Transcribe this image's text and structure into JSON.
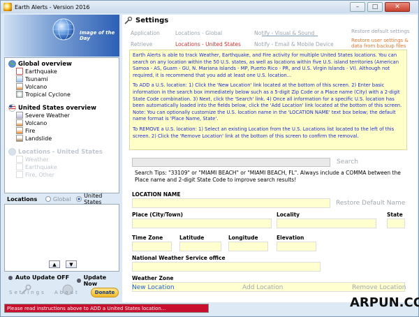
{
  "window": {
    "title": "Earth Alerts - Version 2016",
    "min_glyph": "–",
    "max_glyph": "□",
    "close_glyph": "✕"
  },
  "sidebar": {
    "banner_caption": "Image of the Day",
    "tree": {
      "global": {
        "label": "Global overview",
        "items": [
          "Earthquake",
          "Tsunami",
          "Volcano",
          "Tropical Cyclone"
        ]
      },
      "us": {
        "label": "United States overview",
        "items": [
          "Severe Weather",
          "Volcano",
          "Fire",
          "Landslide"
        ]
      },
      "locations": {
        "label": "Locations - United States",
        "items": [
          "Weather",
          "Earthquake",
          "Fire, Other"
        ]
      }
    },
    "locations_label": "Locations",
    "radio_global": "Global",
    "radio_us": "United States",
    "up_glyph": "▲",
    "down_glyph": "▼",
    "auto_update": "Auto Update OFF",
    "update_now": "Update Now",
    "settings_link": "Settings",
    "about_link": "About",
    "donate": "Donate"
  },
  "main": {
    "header": "Settings",
    "tabs": {
      "application": "Application",
      "locations_global": "Locations - Global",
      "notify_visual": "Notify - Visual & Sound",
      "restore_defaults": "Restore default settings",
      "retrieve": "Retrieve",
      "locations_us": "Locations - United States",
      "notify_email": "Notify - Email & Mobile Device",
      "restore_backup_1": "Restore user settings &",
      "restore_backup_2": "data from backup files"
    },
    "instructions": {
      "p1": "Earth Alerts is able to track Weather, Earthquake, and Fire activity for multiple United States locations. You can search on any location within the 50 U.S. states, as well as locations within five U.S. island territories (American Samoa - AS, Guam - GU, N. Mariana Islands - MP, Puerto Rico - PR, and U.S. Virgin Islands - VI). Although not required, it is recommend that you add at least one U.S. location...",
      "p2": "To ADD a U.S. location: 1) Click the 'New Location' link located at the bottom of this screen. 2) Enter basic information in the search box immediately below such as a 5-digit Zip Code or a Place name (City) with a 2-digit State Code combination. 3) Next, click the 'Search' link. 4) Once all information for a specific U.S. location has been automatically loaded into the fields below, click the 'Add Location' link located at the bottom of this screen. Note: You can optionally customize the U.S. location name in the 'LOCATION NAME' text box below; the default name format is 'Place Name, State'.",
      "p3": "To REMOVE a U.S. location: 1) Select an existing Location from the U.S. Locations list located to the left of this screen. 2) Click the 'Remove Location' link at the bottom of this screen to confirm the removal."
    },
    "search_value": "",
    "search_label": "Search",
    "search_tips": "Search Tips: \"33109\" or \"MIAMI BEACH\" or \"MIAMI BEACH, FL\". Always include a COMMA between the Place name and 2-digit State Code to improve search results!",
    "fields": {
      "location_name": "LOCATION NAME",
      "restore_default_name": "Restore Default Name",
      "place": "Place (City/Town)",
      "locality": "Locality",
      "state": "State",
      "time_zone": "Time Zone",
      "latitude": "Latitude",
      "longitude": "Longitude",
      "elevation": "Elevation",
      "nws_office": "National Weather Service office",
      "weather_zone": "Weather Zone"
    },
    "actions": {
      "new_location": "New Location",
      "add_location": "Add Location",
      "remove_location": "Remove Location"
    }
  },
  "status": {
    "message": "Please read instructions above to ADD a United States location..."
  },
  "watermark": "ARPUN.COM",
  "colors": {
    "link_blue": "#1f5fd0",
    "instruction_text": "#1a2ad0",
    "status_red": "#c8102e",
    "field_yellow": "#ffffd0",
    "active_tab": "#cc3333"
  }
}
